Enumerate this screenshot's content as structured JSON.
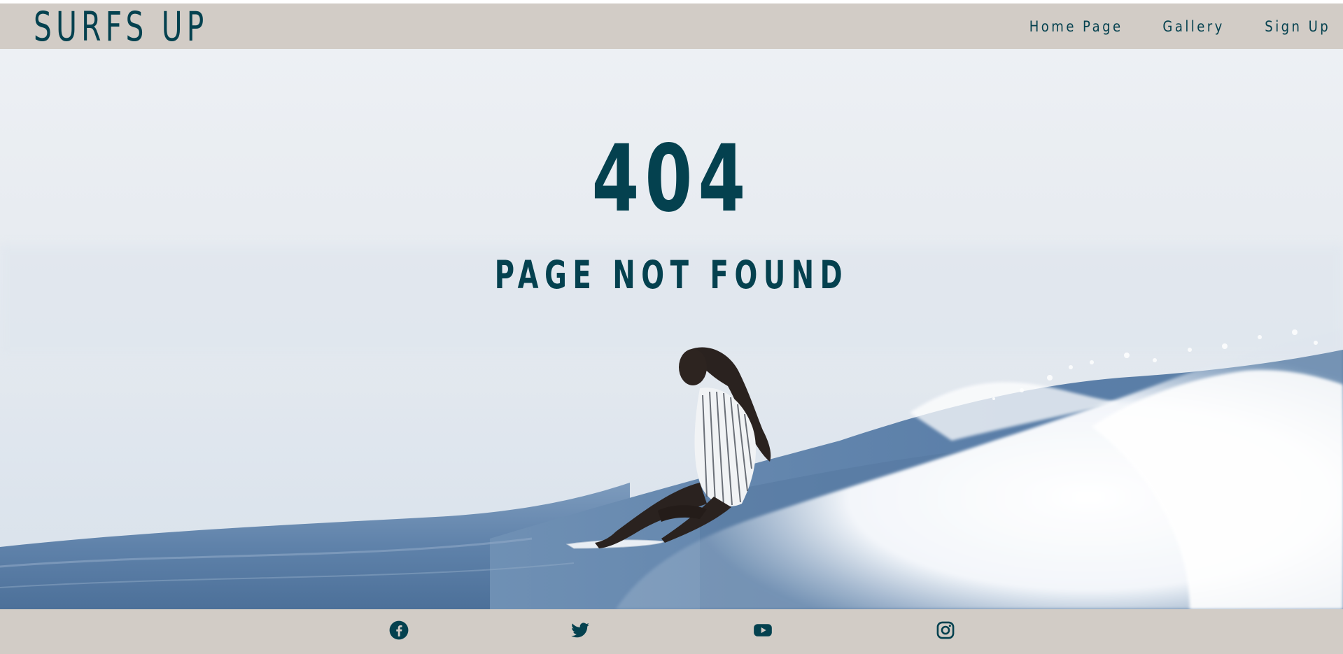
{
  "site": {
    "logo": "SURFS UP"
  },
  "nav": {
    "items": [
      {
        "label": "Home Page"
      },
      {
        "label": "Gallery"
      },
      {
        "label": "Sign Up"
      }
    ]
  },
  "hero": {
    "error_code": "404",
    "error_message": "PAGE NOT FOUND",
    "image": "surfer-riding-wave-photo"
  },
  "footer": {
    "social": [
      {
        "icon": "facebook-icon"
      },
      {
        "icon": "twitter-icon"
      },
      {
        "icon": "youtube-icon"
      },
      {
        "icon": "instagram-icon"
      }
    ]
  },
  "colors": {
    "brand": "#04414f",
    "bar": "#d2ccc6"
  }
}
